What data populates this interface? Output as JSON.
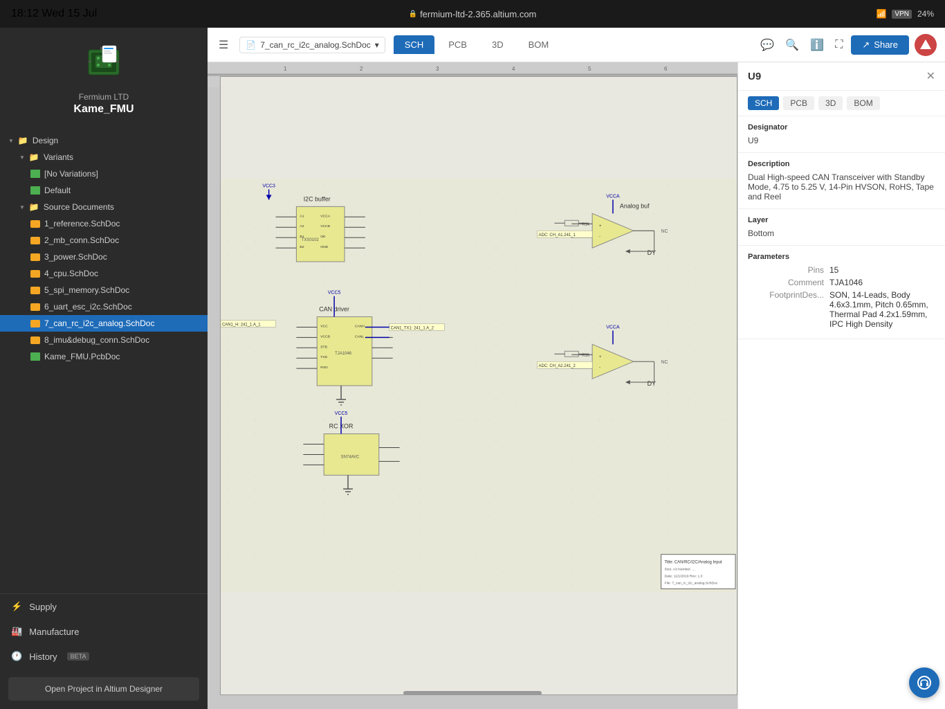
{
  "topbar": {
    "time": "18:12",
    "date": "Wed 15 Jul",
    "url": "fermium-ltd-2.365.altium.com",
    "battery": "24%"
  },
  "sidebar": {
    "company": "Fermium LTD",
    "project": "Kame_FMU",
    "tree": {
      "design_label": "Design",
      "variants_label": "Variants",
      "no_variations_label": "[No Variations]",
      "default_label": "Default",
      "source_docs_label": "Source Documents",
      "files": [
        "1_reference.SchDoc",
        "2_mb_conn.SchDoc",
        "3_power.SchDoc",
        "4_cpu.SchDoc",
        "5_spi_memory.SchDoc",
        "6_uart_esc_i2c.SchDoc",
        "7_can_rc_i2c_analog.SchDoc",
        "8_imu&debug_conn.SchDoc",
        "Kame_FMU.PcbDoc"
      ]
    },
    "bottom_items": [
      {
        "label": "Supply",
        "icon": "supply-icon"
      },
      {
        "label": "Manufacture",
        "icon": "manufacture-icon"
      },
      {
        "label": "History",
        "badge": "BETA",
        "icon": "history-icon"
      }
    ],
    "open_project_btn": "Open Project in Altium Designer"
  },
  "toolbar": {
    "file_selector": "7_can_rc_i2c_analog.SchDoc",
    "tabs": [
      "SCH",
      "PCB",
      "3D",
      "BOM"
    ],
    "active_tab": "SCH",
    "share_label": "Share"
  },
  "properties": {
    "component_id": "U9",
    "tabs": [
      "SCH",
      "PCB",
      "3D",
      "BOM"
    ],
    "designator_label": "Designator",
    "designator_value": "U9",
    "description_label": "Description",
    "description_value": "Dual High-speed CAN Transceiver with Standby Mode, 4.75 to 5.25 V, 14-Pin HVSON, RoHS, Tape and Reel",
    "layer_label": "Layer",
    "layer_value": "Bottom",
    "parameters_label": "Parameters",
    "params": [
      {
        "label": "Pins",
        "value": "15"
      },
      {
        "label": "Comment",
        "value": "TJA1046"
      },
      {
        "label": "FootprintDes...",
        "value": "SON, 14-Leads, Body 4.6x3.1mm, Pitch 0.65mm, Thermal Pad 4.2x1.59mm, IPC High Density"
      }
    ]
  },
  "schematic": {
    "labels": [
      "I2C buffer",
      "CAN driver",
      "RC XOR",
      "Analog buf"
    ],
    "file_title": "CAN/RC/I2C/Analog Inputs"
  }
}
